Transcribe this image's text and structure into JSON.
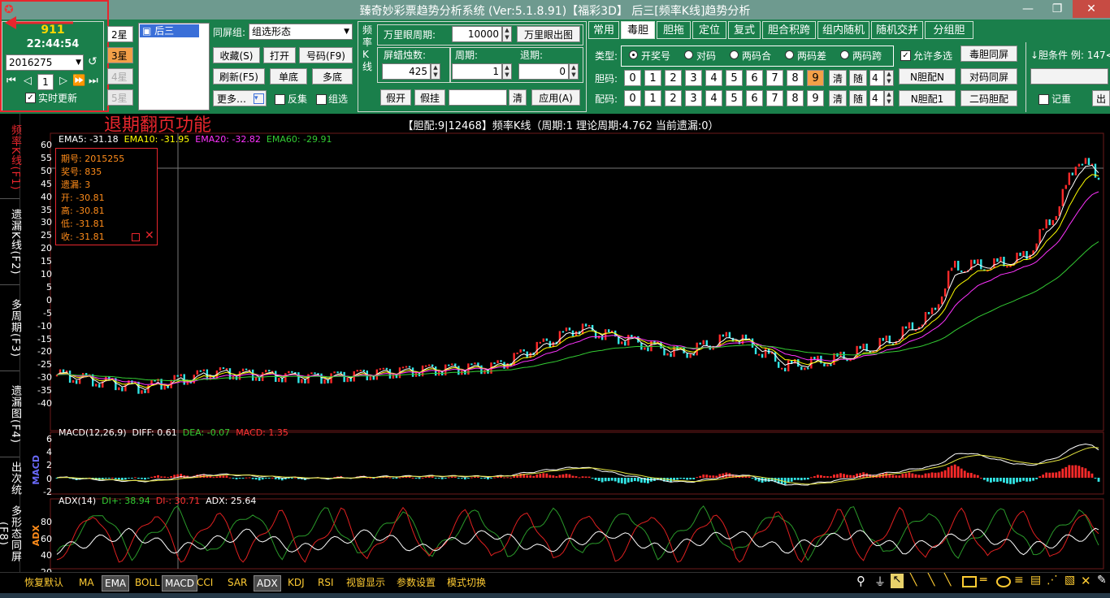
{
  "window": {
    "title": "臻奇妙彩票趋势分析系统 (Ver:5.1.8.91)【福彩3D】   后三[频率K线]趋势分析",
    "minimize": "—",
    "maximize": "❐",
    "close": "✕"
  },
  "left_panel": {
    "count": "911",
    "clock": "22:44:54",
    "period": "2016275",
    "page": "1",
    "realtime_label": "实时更新"
  },
  "annotation": {
    "text": "退期翻页功能",
    "color": "#e8262d"
  },
  "stars": [
    "2星",
    "3星",
    "4星",
    "5星"
  ],
  "list_item": "后三",
  "group_panel": {
    "label": "同屏组:",
    "selected": "组选形态",
    "buttons": [
      "收藏(S)",
      "打开",
      "号码(F9)",
      "刷新(F5)",
      "单底",
      "多底",
      "更多…"
    ],
    "checkbox_anti": "反集",
    "checkbox_group": "组选"
  },
  "freq_panel": {
    "side_label": "频率K线",
    "wanli_label": "万里眼周期:",
    "wanli_value": "10000",
    "wanli_button": "万里眼出图",
    "screen_label": "屏蜡烛数:",
    "screen_value": "425",
    "period_label": "周期:",
    "period_value": "1",
    "back_label": "退期:",
    "back_value": "0",
    "fake_open": "假开",
    "fake_hang": "假挂",
    "clear": "清",
    "apply": "应用(A)"
  },
  "tabs": [
    "常用",
    "毒胆",
    "胆拖",
    "定位",
    "复式",
    "胆合积跨",
    "组内随机",
    "随机交并",
    "分组胆"
  ],
  "active_tab": "毒胆",
  "dan_panel": {
    "type_label": "类型:",
    "types": [
      "开奖号",
      "对码",
      "两码合",
      "两码差",
      "两码跨"
    ],
    "allow_multi": "允许多选",
    "dan_label": "胆码:",
    "pei_label": "配码:",
    "digits": [
      "0",
      "1",
      "2",
      "3",
      "4",
      "5",
      "6",
      "7",
      "8",
      "9"
    ],
    "clear": "清",
    "random": "随",
    "random_value": "4",
    "side_buttons": [
      "毒胆同屏",
      "N胆配N",
      "对码同屏",
      "N胆配1",
      "二码胆配"
    ],
    "condition_label": "↓胆条件 例: 147<",
    "note_label": "记重"
  },
  "chart_header": "【胆配:9|12468】频率K线（周期:1  理论周期:4.762  当前遗漏:0）",
  "ema": {
    "ema5": "EMA5: -31.18",
    "ema10": "EMA10: -31.95",
    "ema20": "EMA20: -32.82",
    "ema60": "EMA60: -29.91",
    "colors": {
      "ema5": "#ffffff",
      "ema10": "#ffff00",
      "ema20": "#ff33ff",
      "ema60": "#33cc33"
    }
  },
  "tooltip": {
    "lines": [
      "期号: 2015255",
      "奖号: 835",
      "遗漏: 3",
      "开: -30.81",
      "高: -30.81",
      "低: -31.81",
      "收: -31.81"
    ]
  },
  "left_nav": [
    "频率K线(F1)",
    "遗漏K线(F2)",
    "多周期(F3)",
    "遗漏图(F4)",
    "出次统",
    "多形态同屏(F8)"
  ],
  "main_axis": [
    "60",
    "55",
    "50",
    "45",
    "40",
    "35",
    "30",
    "25",
    "20",
    "15",
    "10",
    "5",
    "0",
    "-5",
    "-10",
    "-15",
    "-20",
    "-25",
    "-30",
    "-35",
    "-40"
  ],
  "macd": {
    "label": "MACD(12,26,9)",
    "diff": "DIFF: 0.61",
    "dea": "DEA: -0.07",
    "macd": "MACD: 1.35",
    "axis": [
      "6",
      "4",
      "2",
      "0",
      "-2"
    ],
    "side": "MACD"
  },
  "adx": {
    "label": "ADX(14)",
    "di_plus": "DI+: 38.94",
    "di_minus": "DI-: 30.71",
    "adx": "ADX: 25.64",
    "axis": [
      "80",
      "60",
      "40",
      "20"
    ],
    "side": "ADX"
  },
  "bottom_bar": [
    "恢复默认",
    "MA",
    "EMA",
    "BOLL",
    "MACD",
    "CCI",
    "SAR",
    "ADX",
    "KDJ",
    "RSI",
    "视窗显示",
    "参数设置",
    "模式切换"
  ],
  "bottom_boxed": [
    "EMA",
    "MACD",
    "ADX"
  ]
}
